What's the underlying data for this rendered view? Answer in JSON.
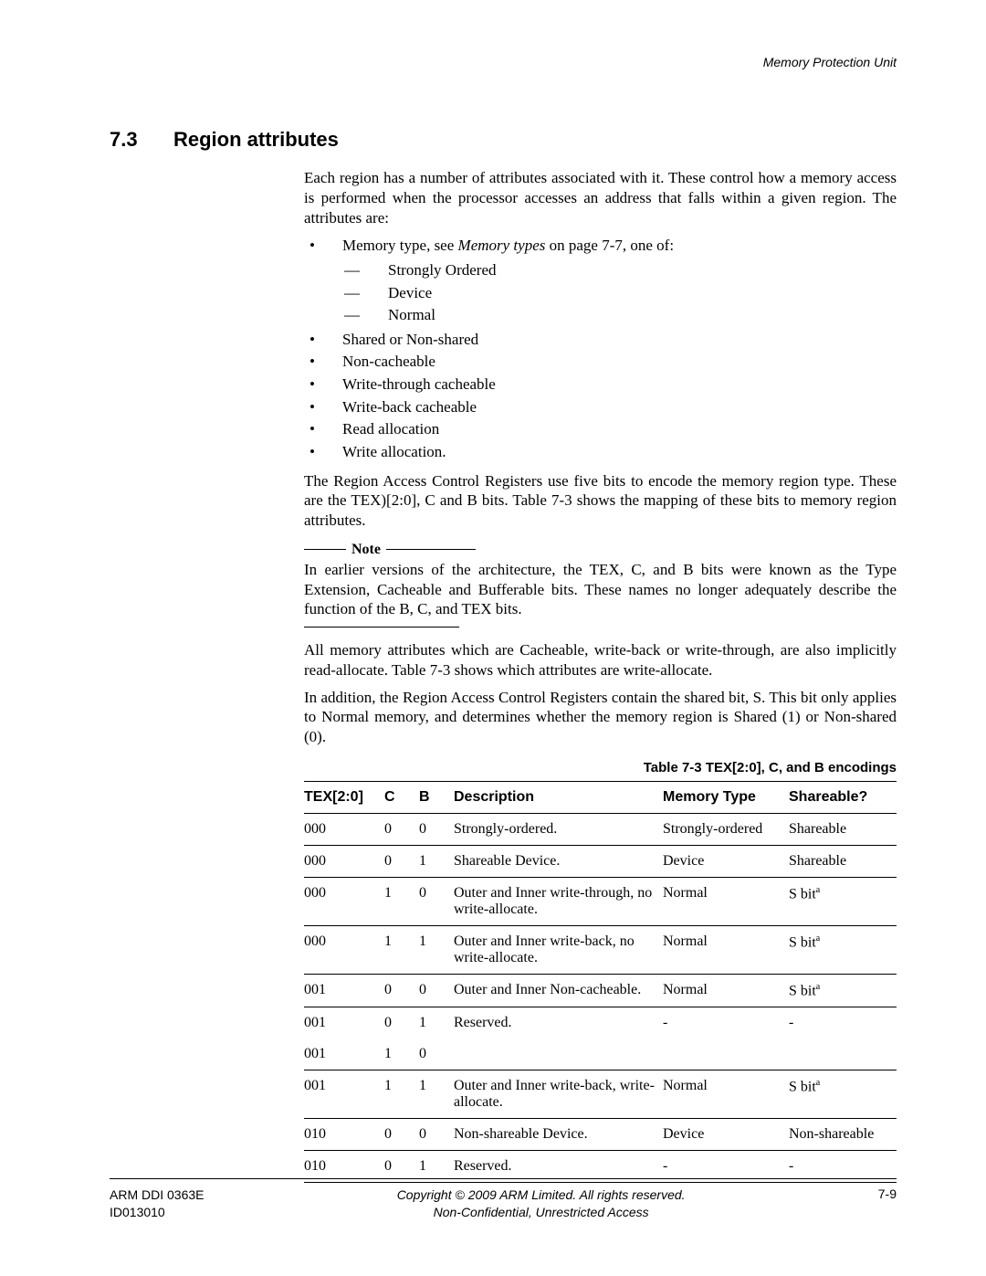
{
  "header": {
    "right": "Memory Protection Unit"
  },
  "section": {
    "number": "7.3",
    "title": "Region attributes"
  },
  "intro": "Each region has a number of attributes associated with it. These control how a memory access is performed when the processor accesses an address that falls within a given region. The attributes are:",
  "bullets": {
    "b0_pre": "Memory type, see ",
    "b0_em": "Memory types",
    "b0_post": " on page 7-7, one of:",
    "b0_sub": [
      "Strongly Ordered",
      "Device",
      "Normal"
    ],
    "b1": "Shared or Non-shared",
    "b2": "Non-cacheable",
    "b3": "Write-through cacheable",
    "b4": "Write-back cacheable",
    "b5": "Read allocation",
    "b6": "Write allocation."
  },
  "para2": "The Region Access Control Registers use five bits to encode the memory region type. These are the TEX)[2:0], C and B bits. Table 7-3 shows the mapping of these bits to memory region attributes.",
  "note": {
    "label": "Note",
    "body": "In earlier versions of the architecture, the TEX, C, and B bits were known as the Type Extension, Cacheable and Bufferable bits. These names no longer adequately describe the function of the B, C, and TEX bits."
  },
  "para3": "All memory attributes which are Cacheable, write-back or write-through, are also implicitly read-allocate. Table 7-3 shows which attributes are write-allocate.",
  "para4": "In addition, the Region Access Control Registers contain the shared bit, S. This bit only applies to Normal memory, and determines whether the memory region is Shared (1) or Non-shared (0).",
  "table": {
    "caption": "Table 7-3 TEX[2:0], C, and B encodings",
    "headers": [
      "TEX[2:0]",
      "C",
      "B",
      "Description",
      "Memory Type",
      "Shareable?"
    ],
    "rows": [
      {
        "tex": "000",
        "c": "0",
        "b": "0",
        "desc": "Strongly-ordered.",
        "mem": "Strongly-ordered",
        "share": "Shareable",
        "sup": false
      },
      {
        "tex": "000",
        "c": "0",
        "b": "1",
        "desc": "Shareable Device.",
        "mem": "Device",
        "share": "Shareable",
        "sup": false
      },
      {
        "tex": "000",
        "c": "1",
        "b": "0",
        "desc": "Outer and Inner write-through, no write-allocate.",
        "mem": "Normal",
        "share": "S bit",
        "sup": true
      },
      {
        "tex": "000",
        "c": "1",
        "b": "1",
        "desc": "Outer and Inner write-back, no write-allocate.",
        "mem": "Normal",
        "share": "S bit",
        "sup": true
      },
      {
        "tex": "001",
        "c": "0",
        "b": "0",
        "desc": "Outer and Inner Non-cacheable.",
        "mem": "Normal",
        "share": "S bit",
        "sup": true
      },
      {
        "tex": "001",
        "c": "0",
        "b": "1",
        "desc": "Reserved.",
        "mem": "-",
        "share": "-",
        "sup": false
      },
      {
        "tex": "001",
        "c": "1",
        "b": "0",
        "desc": "",
        "mem": "",
        "share": "",
        "sup": false
      },
      {
        "tex": "001",
        "c": "1",
        "b": "1",
        "desc": "Outer and Inner write-back, write-allocate.",
        "mem": "Normal",
        "share": "S bit",
        "sup": true
      },
      {
        "tex": "010",
        "c": "0",
        "b": "0",
        "desc": "Non-shareable Device.",
        "mem": "Device",
        "share": "Non-shareable",
        "sup": false
      },
      {
        "tex": "010",
        "c": "0",
        "b": "1",
        "desc": "Reserved.",
        "mem": "-",
        "share": "-",
        "sup": false
      }
    ]
  },
  "footer": {
    "left1": "ARM DDI 0363E",
    "left2": "ID013010",
    "center1": "Copyright © 2009 ARM Limited. All rights reserved.",
    "center2": "Non-Confidential, Unrestricted Access",
    "right": "7-9"
  }
}
